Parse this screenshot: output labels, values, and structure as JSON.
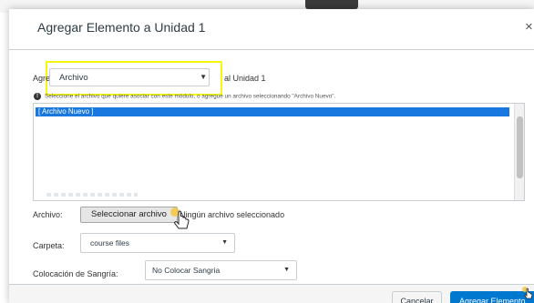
{
  "dialog": {
    "title": "Agregar Elemento a Unidad 1",
    "close_label": "×"
  },
  "add_row": {
    "label": "Agregar",
    "type_selected": "Archivo",
    "unit_label": "al Unidad 1"
  },
  "info_text": "Seleccione el archivo que quiere asociar con este módulo, o agregue un archivo seleccionando \"Archivo Nuevo\".",
  "file_list": {
    "selected_option": "[ Archivo Nuevo ]"
  },
  "file_row": {
    "label": "Archivo:",
    "choose_button": "Seleccionar archivo",
    "no_file_text": "Ningún archivo seleccionado"
  },
  "folder_row": {
    "label": "Carpeta:",
    "selected": "course files"
  },
  "indent_row": {
    "label": "Colocación de Sangría:",
    "selected": "No Colocar Sangria"
  },
  "footer": {
    "cancel_label": "Cancelar",
    "submit_label": "Agregar Elemento"
  },
  "icons": {
    "close": "close-icon",
    "info": "info-icon",
    "caret": "caret-down-icon",
    "pointer": "hand-pointer-icon"
  },
  "colors": {
    "accent": "#0078d0",
    "selection": "#1878e0",
    "highlight": "#f7f70f"
  }
}
